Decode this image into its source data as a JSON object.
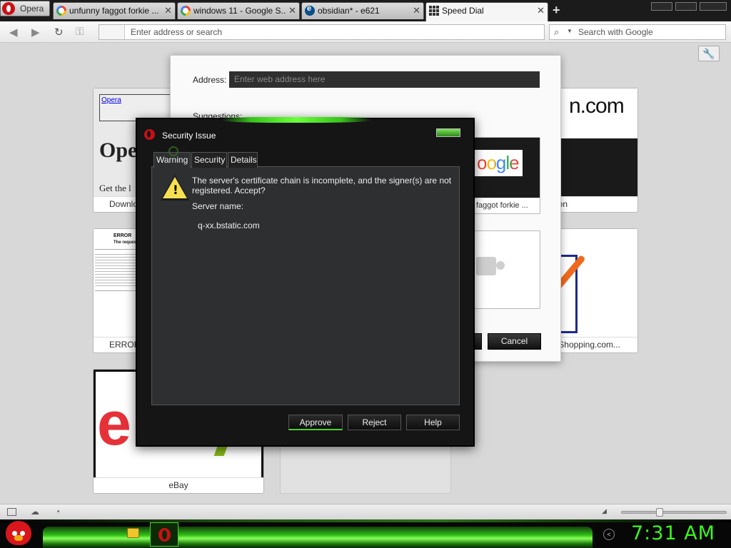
{
  "browser": {
    "menu_label": "Opera",
    "tabs": [
      {
        "title": "unfunny faggot forkie ...",
        "icon": "google-icon",
        "active": false
      },
      {
        "title": "windows 11 - Google S...",
        "icon": "google-icon",
        "active": false
      },
      {
        "title": "obsidian* - e621",
        "icon": "e621-icon",
        "active": false
      },
      {
        "title": "Speed Dial",
        "icon": "speed-dial-icon",
        "active": true
      }
    ],
    "address_placeholder": "Enter address or search",
    "search_placeholder": "Search with Google"
  },
  "speed_dial": {
    "tiles": [
      {
        "caption": "Downlo",
        "thumb_heading": "Ope",
        "thumb_sub": "Get the l",
        "thumb_link": "Opera"
      },
      {
        "caption": "on",
        "thumb_text": "n.com"
      },
      {
        "caption": "ERROR",
        "thumb_heading": "ERROR",
        "thumb_sub": "The requeste"
      },
      {
        "caption": "Shopping.com..."
      },
      {
        "caption": "eBay",
        "thumb_logo": "e"
      },
      {
        "caption": ""
      }
    ],
    "google_tile": {
      "caption": "faggot forkie ...",
      "logo": "oogle"
    }
  },
  "add_dialog": {
    "address_label": "Address:",
    "address_placeholder": "Enter web address here",
    "suggestions_label": "Suggestions:",
    "cancel_label": "Cancel"
  },
  "security_dialog": {
    "title": "Security Issue",
    "tabs": [
      "Warning",
      "Security",
      "Details"
    ],
    "message": "The server's certificate chain is incomplete, and the signer(s) are not registered. Accept?",
    "server_name_label": "Server name:",
    "server_name_value": "q-xx.bstatic.com",
    "buttons": {
      "approve": "Approve",
      "reject": "Reject",
      "help": "Help"
    },
    "accent": "#4bd12a"
  },
  "taskbar": {
    "clock": "7:31 AM",
    "clock_color": "#3cf51d"
  },
  "colors": {
    "opera_red": "#cc0f16",
    "taskbar_green": "#2fbf17"
  }
}
